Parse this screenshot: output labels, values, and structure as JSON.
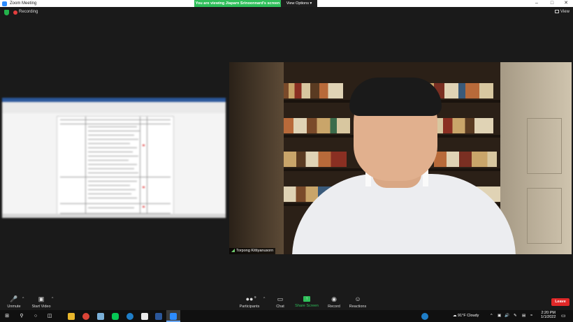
{
  "window": {
    "title": "Zoom Meeting",
    "controls": [
      "–",
      "□",
      "✕"
    ]
  },
  "share_banner": {
    "text": "You are viewing Jiaparn Srinoonnard's screen",
    "view_options": "View Options",
    "view_options_caret": "▾"
  },
  "meeting_top": {
    "recording_label": "Recording",
    "view_label": "View"
  },
  "video_tile": {
    "participant_name": "Torpong Kittiyanusorn"
  },
  "toolbar": {
    "unmute": "Unmute",
    "start_video": "Start Video",
    "participants": "Participants",
    "participants_count": "9",
    "chat": "Chat",
    "share_screen": "Share Screen",
    "record": "Record",
    "reactions": "Reactions",
    "leave": "Leave",
    "caret": "^"
  },
  "taskbar": {
    "weather_temp": "91°F",
    "weather_desc": "Cloudy",
    "time": "2:20 PM",
    "date": "1/1/2022"
  },
  "colors": {
    "share_green": "#2fbf5a",
    "leave_red": "#e02828",
    "zoom_blue": "#2d8cff"
  }
}
